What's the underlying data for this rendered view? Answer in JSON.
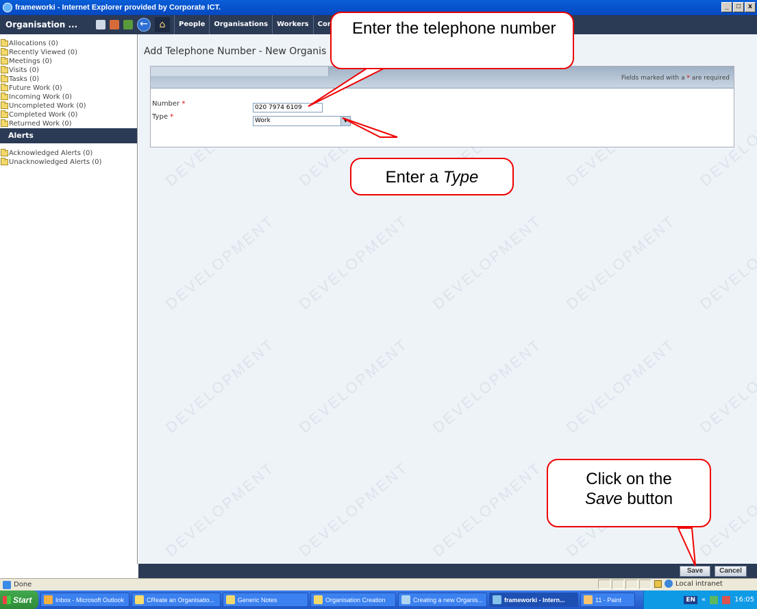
{
  "window": {
    "title": "frameworki - Internet Explorer provided by Corporate ICT.",
    "buttons": [
      "_",
      "□",
      "x"
    ]
  },
  "navbar": {
    "org_menu": "Organisation ...",
    "tabs": [
      "People",
      "Organisations",
      "Workers",
      "Contra"
    ]
  },
  "sidebar": {
    "items": [
      "Allocations (0)",
      "Recently Viewed (0)",
      "Meetings (0)",
      "Visits (0)",
      "Tasks (0)",
      "Future Work (0)",
      "Incoming Work (0)",
      "Uncompleted Work (0)",
      "Completed Work (0)",
      "Returned Work (0)"
    ],
    "alerts_header": "Alerts",
    "alert_items": [
      "Acknowledged Alerts (0)",
      "Unacknowledged Alerts (0)"
    ]
  },
  "main": {
    "page_title": "Add Telephone Number - New Organis",
    "required_note_prefix": "Fields marked with a",
    "required_note_suffix": "are required",
    "required_marker": "*",
    "number_label": "Number",
    "number_value": "020 7974 6109",
    "type_label": "Type",
    "type_value": "Work",
    "watermark_text": "DEVELOPMENT"
  },
  "actions": {
    "save_label": "Save",
    "cancel_label": "Cancel"
  },
  "statusbar": {
    "status": "Done",
    "zone": "Local intranet"
  },
  "taskbar": {
    "start_label": "Start",
    "tasks": [
      "Inbox - Microsoft Outlook",
      "CReate an Organisatio...",
      "Generic Notes",
      "Organisation Creation",
      "Creating a new Organis...",
      "frameworki - Intern...",
      "11 - Paint"
    ],
    "lang": "EN",
    "clock": "16:05"
  },
  "callouts": {
    "phone": "Enter the telephone number",
    "type_prefix": "Enter a",
    "type_word": "Type",
    "save_line1": "Click on the",
    "save_word": "Save",
    "save_suffix": "button"
  },
  "colors": {
    "nav_dark": "#2b3a55",
    "callout_border": "#e00000",
    "required_star": "#dd0000"
  }
}
